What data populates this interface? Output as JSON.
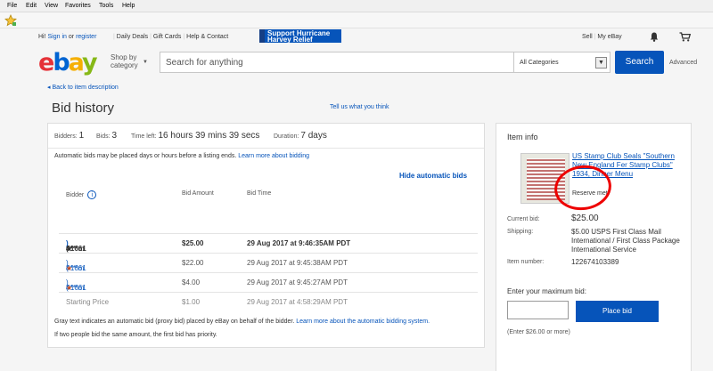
{
  "browser": {
    "menu": [
      "File",
      "Edit",
      "View",
      "Favorites",
      "Tools",
      "Help"
    ]
  },
  "topnav": {
    "hi": "Hi!",
    "sign_in": "Sign in",
    "or": "or",
    "register": "register",
    "daily_deals": "Daily Deals",
    "gift_cards": "Gift Cards",
    "help_contact": "Help & Contact",
    "banner_line1": "Support Hurricane",
    "banner_line2": "Harvey Relief",
    "sell": "Sell",
    "my_ebay": "My eBay"
  },
  "header": {
    "shop_by_line1": "Shop by",
    "shop_by_line2": "category",
    "search_placeholder": "Search for anything",
    "category": "All Categories",
    "search_button": "Search",
    "advanced": "Advanced"
  },
  "page": {
    "back_link": "Back to item description",
    "title": "Bid history",
    "tell_us": "Tell us what you think"
  },
  "stats": {
    "bidders_label": "Bidders:",
    "bidders": "1",
    "bids_label": "Bids:",
    "bids": "3",
    "time_left_label": "Time left:",
    "time_left": "16 hours 39 mins 39 secs",
    "duration_label": "Duration:",
    "duration": "7 days"
  },
  "notes": {
    "auto_bids": "Automatic bids may be placed days or hours before a listing ends.",
    "learn_more_bidding": "Learn more about bidding",
    "hide_auto": "Hide automatic bids",
    "grey_text": "Gray text indicates an automatic bid (proxy bid) placed by eBay on behalf of the bidder.",
    "learn_more_auto": "Learn more about the automatic bidding system.",
    "same_amount": "If two people bid the same amount, the first bid has priority."
  },
  "table": {
    "headers": [
      "Bidder",
      "Bid Amount",
      "Bid Time"
    ],
    "rows": [
      {
        "bidder": "4***m",
        "feedback": "( 1661",
        "amount": "$25.00",
        "time": "29 Aug 2017 at 9:46:35AM PDT"
      },
      {
        "bidder": "4***m",
        "feedback": "( 1661",
        "amount": "$22.00",
        "time": "29 Aug 2017 at 9:45:38AM PDT"
      },
      {
        "bidder": "4***m",
        "feedback": "( 1661",
        "amount": "$4.00",
        "time": "29 Aug 2017 at 9:45:27AM PDT"
      },
      {
        "bidder": "Starting Price",
        "feedback": "",
        "amount": "$1.00",
        "time": "29 Aug 2017 at 4:58:29AM PDT"
      }
    ]
  },
  "item": {
    "heading": "Item info",
    "title": "US  Stamp Club Seals \"Southern New England Fer Stamp Clubs\" 1934, Dinner Menu",
    "reserve": "Reserve met",
    "current_bid_label": "Current bid:",
    "current_bid": "$25.00",
    "shipping_label": "Shipping:",
    "shipping": "$5.00 USPS First Class Mail International / First Class Package International Service",
    "item_number_label": "Item number:",
    "item_number": "122674103389",
    "max_bid_label": "Enter your maximum bid:",
    "place_bid": "Place bid",
    "enter_hint": "(Enter $26.00 or more)"
  },
  "colors": {
    "ebay_blue": "#0654ba",
    "annotation_red": "#e00000"
  }
}
